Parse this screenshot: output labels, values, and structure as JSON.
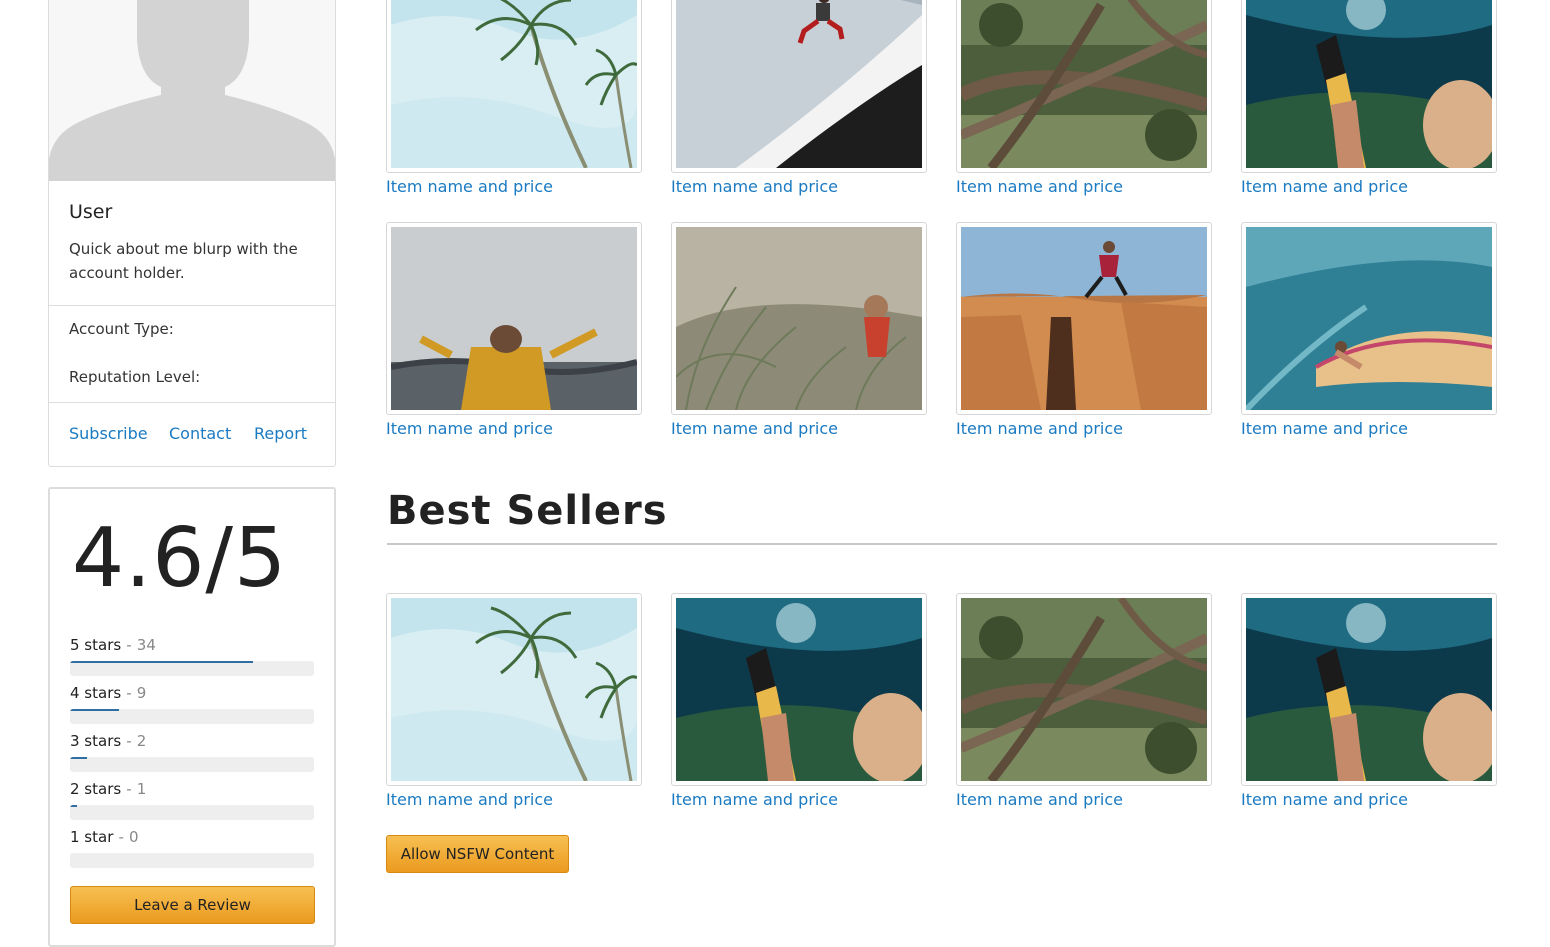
{
  "profile": {
    "name": "User",
    "about": "Quick about me blurp with the account holder.",
    "account_type_label": "Account Type:",
    "reputation_label": "Reputation Level:",
    "links": [
      "Subscribe",
      "Contact",
      "Report"
    ]
  },
  "rating": {
    "score": "4.6/5",
    "breakdown": [
      {
        "label": "5 stars",
        "count": "34",
        "fill": 0.75
      },
      {
        "label": "4 stars",
        "count": "9",
        "fill": 0.2
      },
      {
        "label": "3 stars",
        "count": "2",
        "fill": 0.07
      },
      {
        "label": "2 stars",
        "count": "1",
        "fill": 0.03
      },
      {
        "label": "1 star",
        "count": "0",
        "fill": 0.0
      }
    ],
    "separator": "-",
    "review_button": "Leave a Review"
  },
  "grid": {
    "items": [
      {
        "label": "Item name and price",
        "image": "palm-trees"
      },
      {
        "label": "Item name and price",
        "image": "jumping-athlete"
      },
      {
        "label": "Item name and price",
        "image": "forest-branches"
      },
      {
        "label": "Item name and price",
        "image": "underwater-fins"
      },
      {
        "label": "Item name and price",
        "image": "coast-yellow-jacket"
      },
      {
        "label": "Item name and price",
        "image": "dune-grass"
      },
      {
        "label": "Item name and price",
        "image": "canyon-jump"
      },
      {
        "label": "Item name and price",
        "image": "wave-surfer"
      }
    ]
  },
  "best_sellers": {
    "title": "Best Sellers",
    "items": [
      {
        "label": "Item name and price",
        "image": "palm-trees"
      },
      {
        "label": "Item name and price",
        "image": "underwater-fins"
      },
      {
        "label": "Item name and price",
        "image": "forest-branches"
      },
      {
        "label": "Item name and price",
        "image": "underwater-fins"
      }
    ]
  },
  "nsfw_button": "Allow NSFW Content",
  "colors": {
    "link": "#1a7ac2",
    "button_top": "#f7c052",
    "button_bottom": "#eb9a1f",
    "bar_fill": "#2f6da3"
  }
}
